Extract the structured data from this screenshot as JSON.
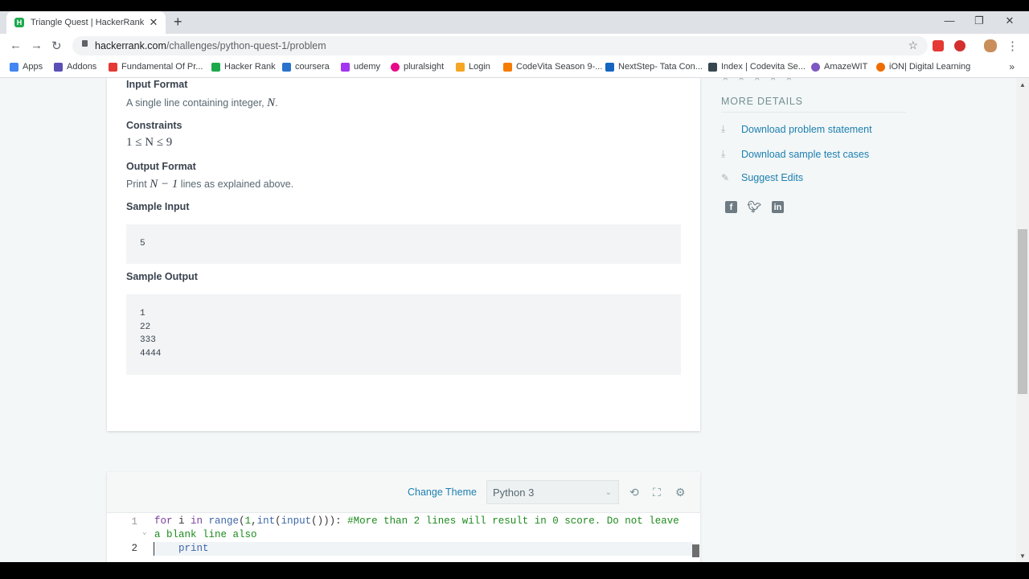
{
  "browser": {
    "tab_title": "Triangle Quest | HackerRank",
    "url_host": "hackerrank.com",
    "url_path": "/challenges/python-quest-1/problem",
    "bookmarks": [
      {
        "label": "Apps",
        "color": "#4285f4"
      },
      {
        "label": "Addons",
        "color": "#5b4fb6"
      },
      {
        "label": "Fundamental Of Pr...",
        "color": "#e53935"
      },
      {
        "label": "Hacker Rank",
        "color": "#1ba94c"
      },
      {
        "label": "coursera",
        "color": "#2a73cc"
      },
      {
        "label": "udemy",
        "color": "#a435f0"
      },
      {
        "label": "pluralsight",
        "color": "#e80a89"
      },
      {
        "label": "Login",
        "color": "#f5a623"
      },
      {
        "label": "CodeVita Season 9-...",
        "color": "#f57c00"
      },
      {
        "label": "NextStep- Tata Con...",
        "color": "#1565c0"
      },
      {
        "label": "Index | Codevita Se...",
        "color": "#37474f"
      },
      {
        "label": "AmazeWIT",
        "color": "#7e57c2"
      },
      {
        "label": "iON| Digital Learning",
        "color": "#ef6c00"
      }
    ]
  },
  "problem": {
    "input_format_heading": "Input Format",
    "input_format_text": "A single line containing integer, ",
    "input_format_var": "N",
    "input_format_end": ".",
    "constraints_heading": "Constraints",
    "constraints_expr": "1 ≤ N ≤ 9",
    "output_format_heading": "Output Format",
    "output_format_pre": "Print ",
    "output_format_expr": "N − 1",
    "output_format_post": " lines as explained above.",
    "sample_input_heading": "Sample Input",
    "sample_input": "5",
    "sample_output_heading": "Sample Output",
    "sample_output": "1\n22\n333\n4444"
  },
  "sidebar": {
    "more_details": "MORE DETAILS",
    "links": [
      "Download problem statement",
      "Download sample test cases",
      "Suggest Edits"
    ]
  },
  "editor": {
    "change_theme": "Change Theme",
    "language": "Python 3",
    "lines": [
      {
        "num": "1",
        "code_kw1": "for",
        "code_mid1": " i ",
        "code_kw2": "in",
        "code_fn1": " range",
        "code_p1": "(",
        "code_num1": "1",
        "code_p2": ",",
        "code_fn2": "int",
        "code_p3": "(",
        "code_fn3": "input",
        "code_p4": "())): ",
        "comment1": "#More than 2 lines will result in 0 score. Do not leave",
        "comment2": "a blank line also"
      },
      {
        "num": "2",
        "code": "    print"
      }
    ]
  }
}
